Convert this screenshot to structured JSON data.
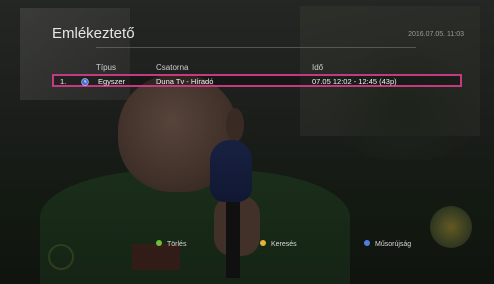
{
  "screen": {
    "title": "Emlékeztető",
    "datetime": "2016.07.05. 11:03"
  },
  "table": {
    "headers": {
      "type": "Típus",
      "channel": "Csatorna",
      "time": "Idő"
    },
    "rows": [
      {
        "index": "1.",
        "icon": "clock-icon",
        "type": "Egyszer",
        "channel": "Duna Tv - Híradó",
        "time": "07.05  12:02 - 12:45 (43p)"
      }
    ]
  },
  "footer": {
    "delete_label": "Törlés",
    "search_label": "Keresés",
    "epg_label": "Műsorújság"
  },
  "colors": {
    "highlight_border": "#c43a82",
    "green_key": "#6fbf3a",
    "yellow_key": "#e2b43a",
    "blue_key": "#4f7fe0"
  }
}
